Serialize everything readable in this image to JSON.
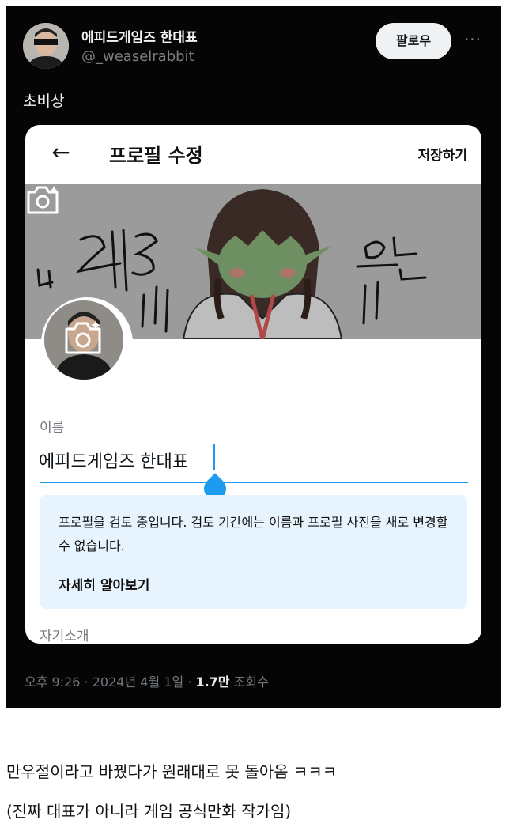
{
  "tweet": {
    "author_name": "에피드게임즈 한대표",
    "author_handle": "@_weaselrabbit",
    "follow_label": "팔로우",
    "more_label": "···",
    "text": "초비상",
    "meta": {
      "time": "오후 9:26",
      "separator": "·",
      "date": "2024년 4월 1일",
      "views_count": "1.7만",
      "views_label": "조회수"
    }
  },
  "edit_profile": {
    "back_icon": "arrow-left-icon",
    "title": "프로필 수정",
    "save_label": "저장하기",
    "banner_text_left": "나 돼3",
    "banner_text_right": "오는",
    "name_label": "이름",
    "name_value": "에피드게임즈 한대표",
    "notice_text": "프로필을 검토 중입니다. 검토 기간에는 이름과 프로필 사진을 새로 변경할 수 없습니다.",
    "notice_link": "자세히 알아보기",
    "bio_label": "자기소개"
  },
  "caption": {
    "line1": "만우절이라고 바꿨다가 원래대로 못 돌아옴 ㅋㅋㅋ",
    "line2": "(진짜 대표가 아니라 게임 공식만화 작가임)"
  },
  "colors": {
    "accent": "#1d9bf0",
    "tweet_bg": "#050505",
    "notice_bg": "#e8f4fd"
  }
}
